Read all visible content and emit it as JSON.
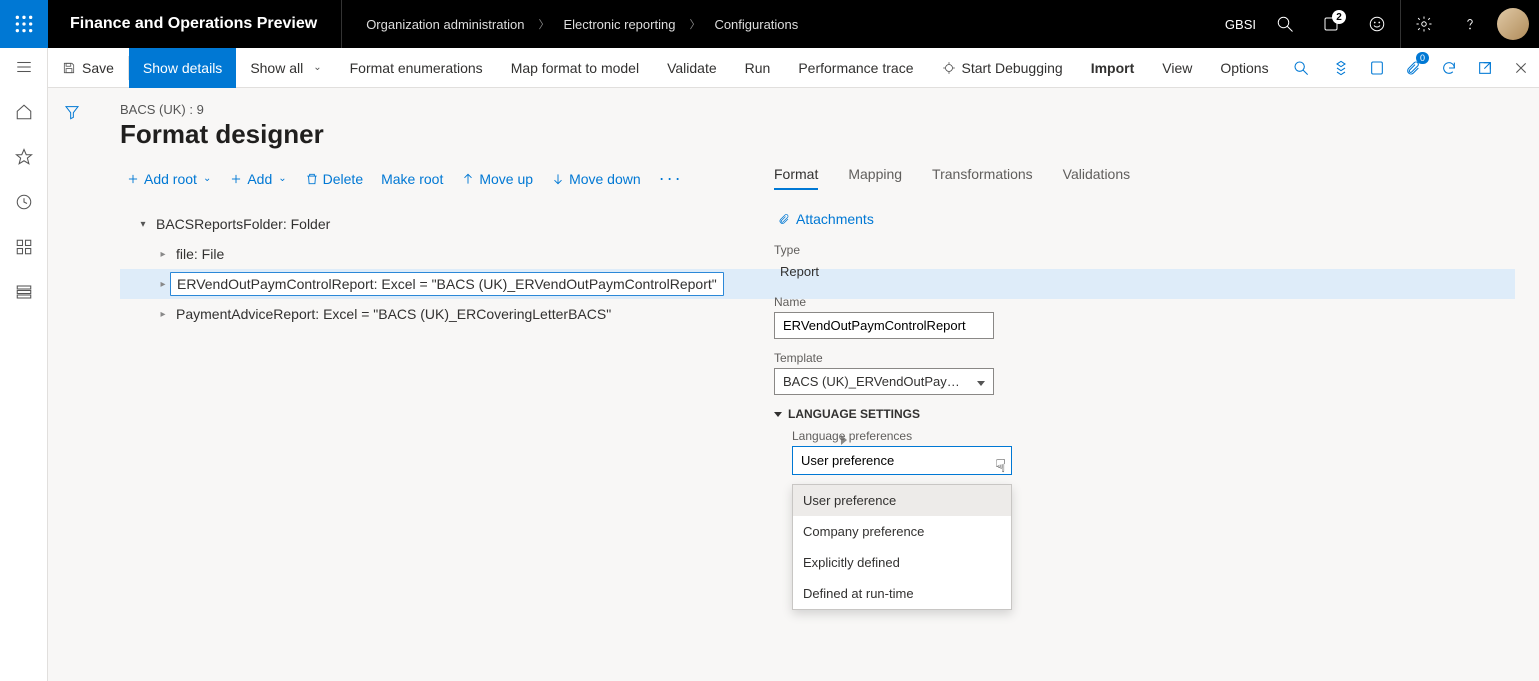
{
  "top": {
    "app_title": "Finance and Operations Preview",
    "breadcrumb": [
      "Organization administration",
      "Electronic reporting",
      "Configurations"
    ],
    "company": "GBSI",
    "notifications_count": "2",
    "attach_count": "0"
  },
  "actionbar": {
    "save": "Save",
    "show_details": "Show details",
    "show_all": "Show all",
    "format_enums": "Format enumerations",
    "map_format": "Map format to model",
    "validate": "Validate",
    "run": "Run",
    "perf_trace": "Performance trace",
    "start_debug": "Start Debugging",
    "import": "Import",
    "view": "View",
    "options": "Options"
  },
  "page": {
    "small_crumb": "BACS (UK) : 9",
    "title": "Format designer"
  },
  "toolbar": {
    "add_root": "Add root",
    "add": "Add",
    "delete": "Delete",
    "make_root": "Make root",
    "move_up": "Move up",
    "move_down": "Move down"
  },
  "tree": {
    "root": "BACSReportsFolder: Folder",
    "n1": "file: File",
    "n2": "ERVendOutPaymControlReport: Excel = \"BACS (UK)_ERVendOutPaymControlReport\"",
    "n3": "PaymentAdviceReport: Excel = \"BACS (UK)_ERCoveringLetterBACS\""
  },
  "tabs": {
    "format": "Format",
    "mapping": "Mapping",
    "transformations": "Transformations",
    "validations": "Validations"
  },
  "details": {
    "attachments": "Attachments",
    "type_label": "Type",
    "type_value": "Report",
    "name_label": "Name",
    "name_value": "ERVendOutPaymControlReport",
    "template_label": "Template",
    "template_value": "BACS (UK)_ERVendOutPaymC…",
    "lang_section": "LANGUAGE SETTINGS",
    "lang_pref_label": "Language preferences",
    "lang_pref_value": "User preference",
    "lang_options": [
      "User preference",
      "Company preference",
      "Explicitly defined",
      "Defined at run-time"
    ]
  }
}
